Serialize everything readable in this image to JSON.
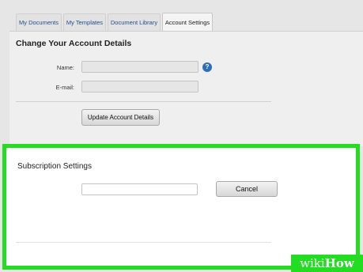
{
  "tabs": [
    {
      "label": "My Documents"
    },
    {
      "label": "My Templates"
    },
    {
      "label": "Document Library"
    },
    {
      "label": "Account Settings",
      "active": true
    }
  ],
  "account": {
    "heading": "Change Your Account Details",
    "name_label": "Name:",
    "email_label": "E-mail:",
    "name_value": "",
    "email_value": "",
    "help_glyph": "?",
    "update_button": "Update Account Details"
  },
  "subscription": {
    "heading": "Subscription Settings",
    "input_value": "",
    "cancel_button": "Cancel"
  },
  "watermark": {
    "part1": "wiki",
    "part2": "How"
  },
  "colors": {
    "highlight": "#22dd22",
    "tab_text": "#1f4f8a",
    "help_icon": "#2f6eb5"
  },
  "icons": {
    "help": "help-icon"
  }
}
